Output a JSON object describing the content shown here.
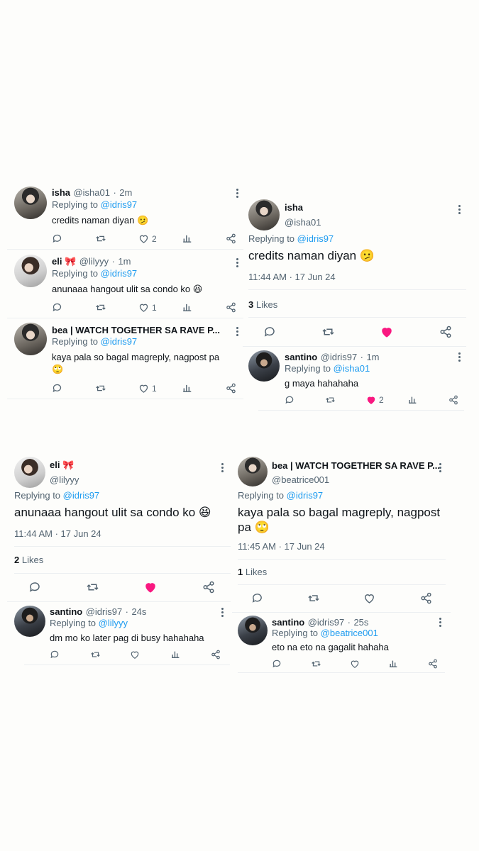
{
  "p1": {
    "r1": {
      "name": "isha",
      "handle": "@isha01",
      "time": "2m",
      "reply_label": "Replying to",
      "reply_to": "@idris97",
      "text": "credits naman diyan 🫤",
      "likes": "2"
    },
    "r2": {
      "name": "eli 🎀",
      "handle": "@lilyyy",
      "time": "1m",
      "reply_label": "Replying to",
      "reply_to": "@idris97",
      "text": "anunaaa hangout ulit sa condo ko 😆",
      "likes": "1"
    },
    "r3": {
      "name": "bea | WATCH TOGETHER SA RAVE P...",
      "reply_label": "Replying to",
      "reply_to": "@idris97",
      "text1": "kaya pala so bagal magreply, nagpost pa",
      "text2": "🙄",
      "likes": "1"
    }
  },
  "p2": {
    "name": "isha",
    "handle": "@isha01",
    "reply_label": "Replying to",
    "reply_to": "@idris97",
    "text": "credits naman diyan 🫤",
    "timestamp": "11:44 AM · 17 Jun 24",
    "likes_count": "3",
    "likes_label": "Likes",
    "sub": {
      "name": "santino",
      "handle": "@idris97",
      "time": "1m",
      "reply_label": "Replying to",
      "reply_to": "@isha01",
      "text": "g maya hahahaha",
      "likes": "2"
    }
  },
  "p3": {
    "name": "eli 🎀",
    "handle": "@lilyyy",
    "reply_label": "Replying to",
    "reply_to": "@idris97",
    "text": "anunaaa hangout ulit sa condo ko 😆",
    "timestamp": "11:44 AM · 17 Jun 24",
    "likes_count": "2",
    "likes_label": "Likes",
    "sub": {
      "name": "santino",
      "handle": "@idris97",
      "time": "24s",
      "reply_label": "Replying to",
      "reply_to": "@lilyyy",
      "text": "dm mo ko later pag di busy hahahaha"
    }
  },
  "p4": {
    "name": "bea | WATCH TOGETHER SA RAVE P...",
    "handle": "@beatrice001",
    "reply_label": "Replying to",
    "reply_to": "@idris97",
    "text1": "kaya pala so bagal magreply, nagpost",
    "text2": "pa 🙄",
    "timestamp": "11:45 AM · 17 Jun 24",
    "likes_count": "1",
    "likes_label": "Likes",
    "sub": {
      "name": "santino",
      "handle": "@idris97",
      "time": "25s",
      "reply_label": "Replying to",
      "reply_to": "@beatrice001",
      "text": "eto na eto na gagalit hahaha"
    }
  },
  "colors": {
    "accent": "#1d9bf0",
    "like": "#f91880",
    "text": "#0f1419",
    "muted": "#536471"
  },
  "icons": [
    "reply-icon",
    "retweet-icon",
    "like-icon",
    "views-icon",
    "share-icon",
    "more-icon"
  ]
}
